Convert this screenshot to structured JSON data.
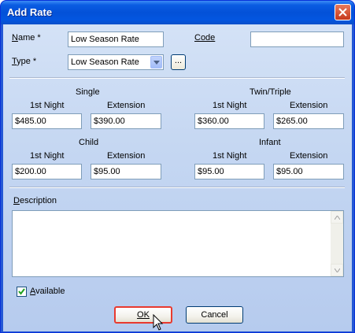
{
  "window": {
    "title": "Add Rate"
  },
  "form": {
    "name_label": "Name *",
    "name_value": "Low Season Rate",
    "code_label": "Code",
    "code_value": "",
    "type_label": "Type *",
    "type_value": "Low Season Rate",
    "type_browse": "..."
  },
  "rates": {
    "single": {
      "title": "Single",
      "first_label": "1st Night",
      "first_value": "$485.00",
      "ext_label": "Extension",
      "ext_value": "$390.00"
    },
    "twin": {
      "title": "Twin/Triple",
      "first_label": "1st Night",
      "first_value": "$360.00",
      "ext_label": "Extension",
      "ext_value": "$265.00"
    },
    "child": {
      "title": "Child",
      "first_label": "1st Night",
      "first_value": "$200.00",
      "ext_label": "Extension",
      "ext_value": "$95.00"
    },
    "infant": {
      "title": "Infant",
      "first_label": "1st Night",
      "first_value": "$95.00",
      "ext_label": "Extension",
      "ext_value": "$95.00"
    }
  },
  "description": {
    "label": "Description",
    "value": ""
  },
  "available": {
    "label": "Available",
    "checked": true
  },
  "buttons": {
    "ok": "OK",
    "cancel": "Cancel"
  }
}
